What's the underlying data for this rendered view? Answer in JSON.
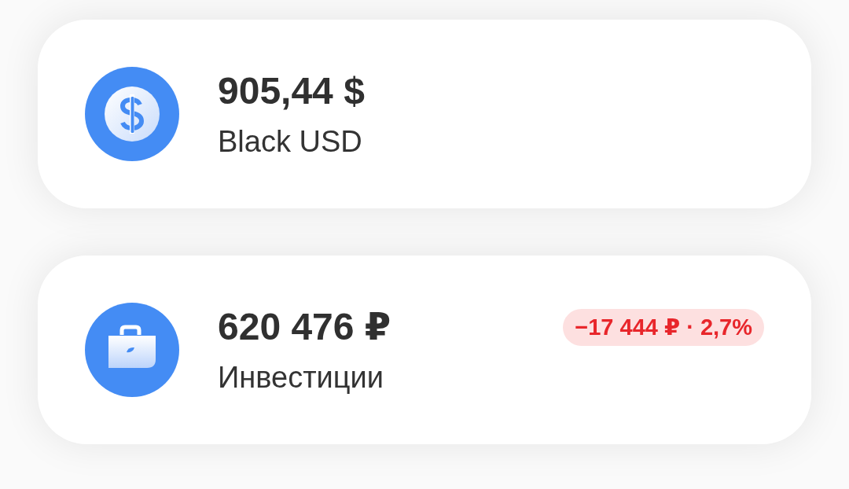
{
  "accounts": [
    {
      "kind": "currency",
      "amount": "905,44 $",
      "name": "Black USD"
    },
    {
      "kind": "portfolio",
      "amount": "620 476 ₽",
      "name": "Инвестиции",
      "change": {
        "text": "−17 444 ₽ · 2,7%",
        "negative": true
      }
    }
  ]
}
